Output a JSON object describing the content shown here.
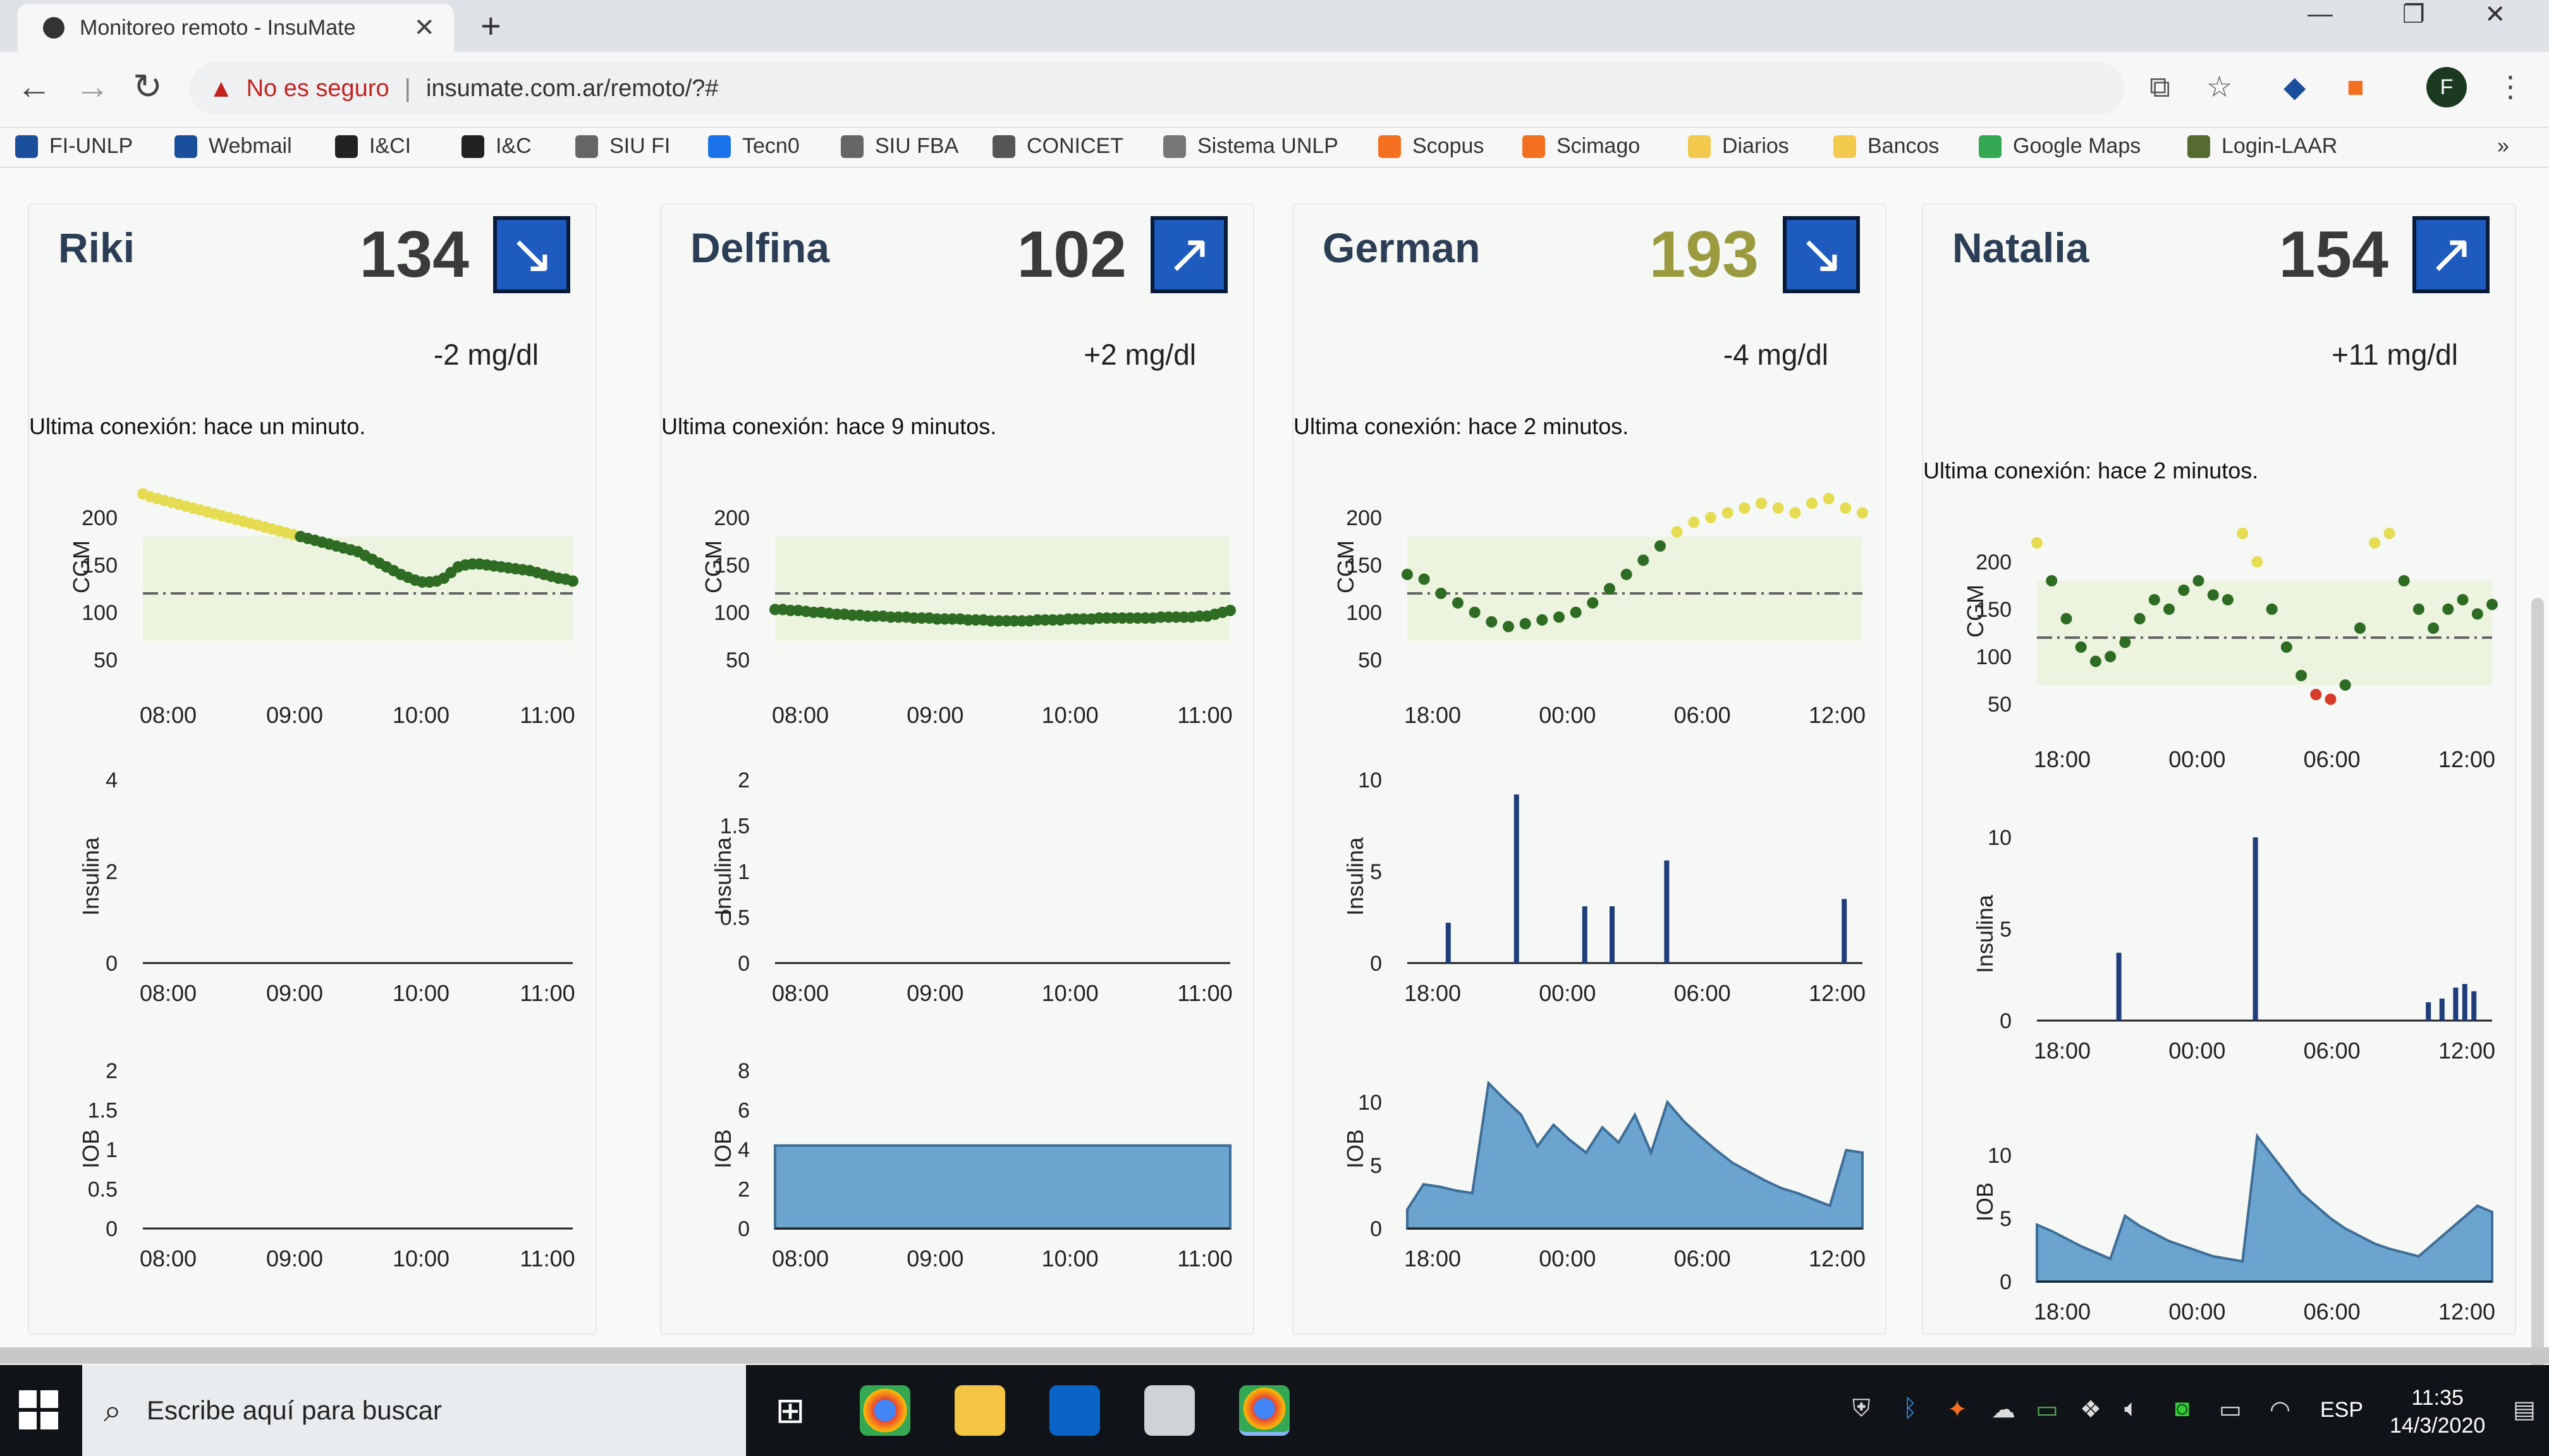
{
  "browser": {
    "tab_title": "Monitoreo remoto - InsuMate",
    "security_label": "No es seguro",
    "url": "insumate.com.ar/remoto/?#",
    "avatar_letter": "F",
    "bookmarks": [
      "FI-UNLP",
      "Webmail",
      "I&CI",
      "I&C",
      "SIU FI",
      "Tecn0",
      "SIU FBA",
      "CONICET",
      "Sistema UNLP",
      "Scopus",
      "Scimago",
      "Diarios",
      "Bancos",
      "Google Maps",
      "Login-LAAR"
    ],
    "bookmark_colors": [
      "#1a4f9c",
      "#1a4f9c",
      "#222",
      "#222",
      "#666",
      "#1a73e8",
      "#666",
      "#555",
      "#777",
      "#f37021",
      "#f37021",
      "#f2c94c",
      "#f2c94c",
      "#34a853",
      "#556b2f"
    ]
  },
  "patients": [
    {
      "name": "Riki",
      "glucose": "134",
      "glucose_color": "#3a3a3a",
      "trend": "down",
      "delta": "-2 mg/dl",
      "last_connection": "Ultima conexión: hace un minuto.",
      "cgm": {
        "ylabel": "CGM",
        "yticks": [
          "200",
          "150",
          "100",
          "50"
        ],
        "xticks": [
          "08:00",
          "09:00",
          "10:00",
          "11:00"
        ],
        "values": [
          225,
          222,
          220,
          218,
          216,
          214,
          212,
          210,
          208,
          206,
          204,
          202,
          200,
          198,
          196,
          194,
          192,
          190,
          188,
          186,
          184,
          182,
          180,
          178,
          176,
          174,
          172,
          170,
          168,
          166,
          164,
          160,
          156,
          152,
          148,
          144,
          140,
          137,
          134,
          132,
          132,
          133,
          136,
          142,
          148,
          150,
          151,
          151,
          150,
          149,
          148,
          147,
          146,
          145,
          144,
          142,
          140,
          138,
          136,
          135,
          133
        ],
        "target": 120
      },
      "insulin": {
        "ylabel": "Insulina",
        "yticks": [
          "4",
          "2",
          "0"
        ],
        "xticks": [
          "08:00",
          "09:00",
          "10:00",
          "11:00"
        ],
        "bars": []
      },
      "iob": {
        "ylabel": "IOB",
        "yticks": [
          "2",
          "1.5",
          "1",
          "0.5",
          "0"
        ],
        "xticks": [
          "08:00",
          "09:00",
          "10:00",
          "11:00"
        ],
        "values": []
      }
    },
    {
      "name": "Delfina",
      "glucose": "102",
      "glucose_color": "#3a3a3a",
      "trend": "up",
      "delta": "+2 mg/dl",
      "last_connection": "Ultima conexión: hace 9 minutos.",
      "cgm": {
        "ylabel": "CGM",
        "yticks": [
          "200",
          "150",
          "100",
          "50"
        ],
        "xticks": [
          "08:00",
          "09:00",
          "10:00",
          "11:00"
        ],
        "values": [
          103,
          103,
          102,
          102,
          101,
          100,
          100,
          99,
          98,
          98,
          97,
          97,
          96,
          96,
          96,
          95,
          95,
          95,
          94,
          94,
          94,
          93,
          93,
          93,
          93,
          92,
          92,
          92,
          91,
          91,
          91,
          91,
          91,
          91,
          92,
          92,
          92,
          92,
          93,
          93,
          93,
          93,
          94,
          94,
          94,
          94,
          94,
          94,
          94,
          94,
          95,
          95,
          95,
          95,
          95,
          96,
          96,
          98,
          100,
          102
        ],
        "target": 120
      },
      "insulin": {
        "ylabel": "Insulina",
        "yticks": [
          "2",
          "1.5",
          "1",
          "0.5",
          "0"
        ],
        "xticks": [
          "08:00",
          "09:00",
          "10:00",
          "11:00"
        ],
        "bars": []
      },
      "iob": {
        "ylabel": "IOB",
        "yticks": [
          "8",
          "6",
          "4",
          "2",
          "0"
        ],
        "xticks": [
          "08:00",
          "09:00",
          "10:00",
          "11:00"
        ],
        "values": [
          4.2,
          4.2,
          4.2,
          4.2,
          4.2,
          4.2,
          4.2,
          4.2,
          4.2,
          4.2,
          4.2,
          4.2
        ]
      }
    },
    {
      "name": "German",
      "glucose": "193",
      "glucose_color": "#9c9a3e",
      "trend": "down",
      "delta": "-4 mg/dl",
      "last_connection": "Ultima conexión: hace 2 minutos.",
      "cgm": {
        "ylabel": "CGM",
        "yticks": [
          "200",
          "150",
          "100",
          "50"
        ],
        "xticks": [
          "18:00",
          "00:00",
          "06:00",
          "12:00"
        ],
        "values": [
          140,
          135,
          120,
          110,
          100,
          90,
          85,
          88,
          92,
          95,
          100,
          110,
          125,
          140,
          155,
          170,
          185,
          195,
          200,
          205,
          210,
          215,
          210,
          205,
          215,
          220,
          210,
          205
        ],
        "target": 120
      },
      "insulin": {
        "ylabel": "Insulina",
        "yticks": [
          "10",
          "5",
          "0"
        ],
        "xticks": [
          "18:00",
          "00:00",
          "06:00",
          "12:00"
        ],
        "bars": [
          {
            "t": 0.09,
            "v": 2.2
          },
          {
            "t": 0.24,
            "v": 9.2
          },
          {
            "t": 0.39,
            "v": 3.1
          },
          {
            "t": 0.45,
            "v": 3.1
          },
          {
            "t": 0.57,
            "v": 5.6
          },
          {
            "t": 0.96,
            "v": 3.5
          }
        ]
      },
      "iob": {
        "ylabel": "IOB",
        "yticks": [
          "10",
          "5",
          "0"
        ],
        "xticks": [
          "18:00",
          "00:00",
          "06:00",
          "12:00"
        ],
        "values": [
          1.5,
          3.5,
          3.3,
          3.0,
          2.8,
          11.5,
          10.2,
          9.0,
          6.5,
          8.2,
          7.0,
          6.0,
          8.0,
          6.8,
          9.0,
          6.0,
          10.0,
          8.5,
          7.3,
          6.2,
          5.2,
          4.5,
          3.8,
          3.2,
          2.8,
          2.3,
          1.8,
          6.2,
          6.0
        ]
      }
    },
    {
      "name": "Natalia",
      "glucose": "154",
      "glucose_color": "#3a3a3a",
      "trend": "up",
      "delta": "+11 mg/dl",
      "last_connection": "Ultima conexión: hace 2 minutos.",
      "cgm": {
        "ylabel": "CGM",
        "yticks": [
          "200",
          "150",
          "100",
          "50"
        ],
        "xticks": [
          "18:00",
          "00:00",
          "06:00",
          "12:00"
        ],
        "values": [
          220,
          180,
          140,
          110,
          95,
          100,
          115,
          140,
          160,
          150,
          170,
          180,
          165,
          160,
          230,
          200,
          150,
          110,
          80,
          60,
          55,
          70,
          130,
          220,
          230,
          180,
          150,
          130,
          150,
          160,
          145,
          155
        ],
        "target": 120
      },
      "insulin": {
        "ylabel": "Insulina",
        "yticks": [
          "10",
          "5",
          "0"
        ],
        "xticks": [
          "18:00",
          "00:00",
          "06:00",
          "12:00"
        ],
        "bars": [
          {
            "t": 0.18,
            "v": 3.7
          },
          {
            "t": 0.48,
            "v": 10.0
          },
          {
            "t": 0.86,
            "v": 1.0
          },
          {
            "t": 0.89,
            "v": 1.2
          },
          {
            "t": 0.92,
            "v": 1.8
          },
          {
            "t": 0.94,
            "v": 2.0
          },
          {
            "t": 0.96,
            "v": 1.6
          }
        ]
      },
      "iob": {
        "ylabel": "IOB",
        "yticks": [
          "10",
          "5",
          "0"
        ],
        "xticks": [
          "18:00",
          "00:00",
          "06:00",
          "12:00"
        ],
        "values": [
          4.5,
          4.0,
          3.4,
          2.8,
          2.3,
          1.8,
          5.2,
          4.4,
          3.8,
          3.2,
          2.8,
          2.4,
          2.0,
          1.8,
          1.6,
          11.5,
          10.0,
          8.5,
          7.0,
          6.0,
          5.0,
          4.2,
          3.6,
          3.0,
          2.6,
          2.3,
          2.0,
          3.0,
          4.0,
          5.0,
          6.0,
          5.5
        ]
      }
    }
  ],
  "taskbar": {
    "search_placeholder": "Escribe aquí para buscar",
    "language": "ESP",
    "time": "11:35",
    "date": "14/3/2020"
  }
}
